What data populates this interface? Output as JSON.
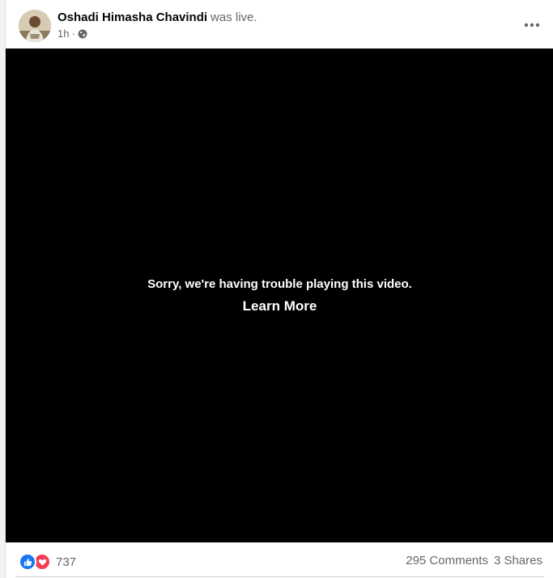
{
  "post": {
    "author": "Oshadi Himasha Chavindi",
    "action": "was live.",
    "time": "1h",
    "separator": "·",
    "audience_icon": "globe-icon",
    "more_icon": "more-horizontal-icon"
  },
  "video": {
    "error_message": "Sorry, we're having trouble playing this video.",
    "learn_more": "Learn More"
  },
  "stats": {
    "reaction_icons": [
      "like-icon",
      "love-icon"
    ],
    "reactions_count": "737",
    "comments": "295 Comments",
    "shares": "3 Shares"
  },
  "colors": {
    "like_blue": "#1877f2",
    "love_red": "#f33e58",
    "secondary_text": "#65676b",
    "primary_text": "#050505"
  }
}
